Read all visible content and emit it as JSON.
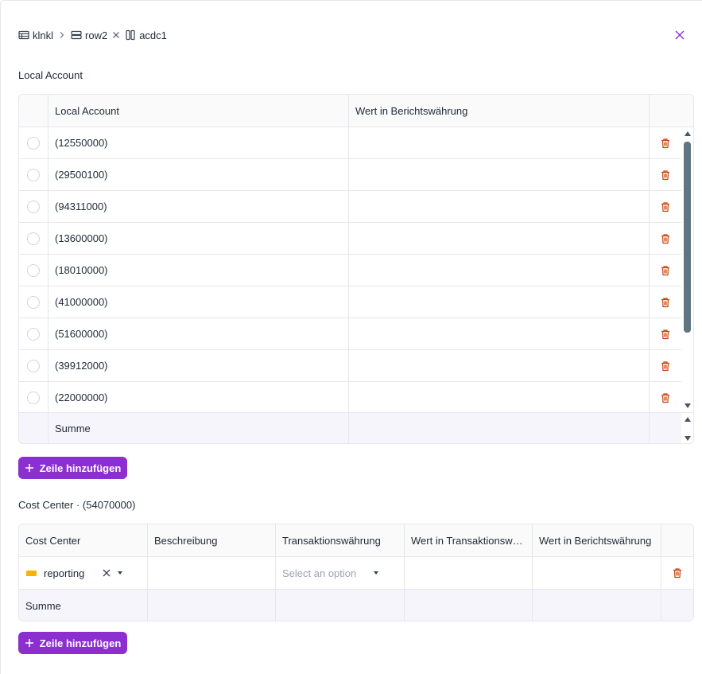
{
  "breadcrumb": {
    "items": [
      {
        "label": "klnkl",
        "icon": "table-icon"
      },
      {
        "label": "row2",
        "icon": "row-icon"
      },
      {
        "label": "acdc1",
        "icon": "column-icon"
      }
    ]
  },
  "local_account": {
    "title": "Local Account",
    "columns": [
      "Local Account",
      "Wert in Berichtswährung"
    ],
    "rows": [
      {
        "account": "(12550000)",
        "value": ""
      },
      {
        "account": "(29500100)",
        "value": ""
      },
      {
        "account": "(94311000)",
        "value": ""
      },
      {
        "account": "(13600000)",
        "value": ""
      },
      {
        "account": "(18010000)",
        "value": ""
      },
      {
        "account": "(41000000)",
        "value": ""
      },
      {
        "account": "(51600000)",
        "value": ""
      },
      {
        "account": "(39912000)",
        "value": ""
      },
      {
        "account": "(22000000)",
        "value": ""
      }
    ],
    "footer": "Summe",
    "add_label": "Zeile hinzufügen"
  },
  "cost_center": {
    "title": "Cost Center · (54070000)",
    "columns": [
      "Cost Center",
      "Beschreibung",
      "Transaktionswährung",
      "Wert in Transaktionswährung",
      "Wert in Berichtswährung"
    ],
    "row": {
      "cost_center": "reporting",
      "description": "",
      "currency_placeholder": "Select an option",
      "value_tx": "",
      "value_report": ""
    },
    "footer": "Summe",
    "add_label": "Zeile hinzufügen"
  },
  "colors": {
    "accent": "#8b2fd1",
    "delete": "#c2410c",
    "swatch": "#f5b400",
    "scrollbar": "#5f7582",
    "footer_bg": "#f6f5fb"
  }
}
